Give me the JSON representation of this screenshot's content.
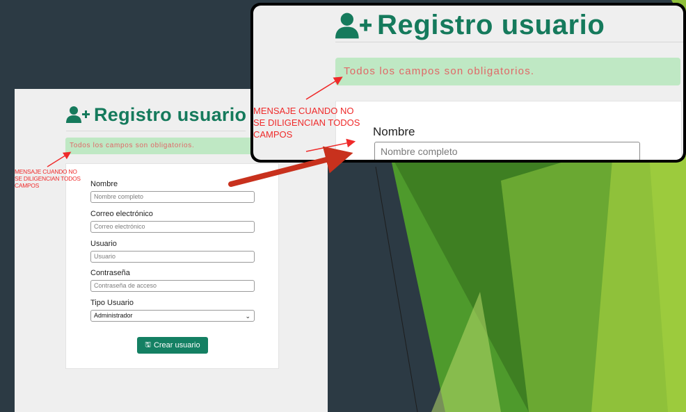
{
  "form": {
    "title": "Registro usuario",
    "alert": "Todos los campos son obligatorios.",
    "fields": [
      {
        "label": "Nombre",
        "placeholder": "Nombre completo"
      },
      {
        "label": "Correo electrónico",
        "placeholder": "Correo electrónico"
      },
      {
        "label": "Usuario",
        "placeholder": "Usuario"
      },
      {
        "label": "Contraseña",
        "placeholder": "Contraseña de acceso"
      }
    ],
    "tipo_label": "Tipo Usuario",
    "tipo_value": "Administrador",
    "submit_label": "Crear usuario",
    "save_glyph": "🖫"
  },
  "annotation": {
    "line1": "MENSAJE CUANDO NO",
    "line2": "SE DILIGENCIAN TODOS",
    "line3": "CAMPOS"
  },
  "icons": [
    "user-plus-icon",
    "save-icon",
    "chevron-down-icon"
  ],
  "colors": {
    "brand_green": "#157a5c",
    "button_green": "#148063",
    "alert_bg": "#bfe8c4",
    "alert_text": "#e06767",
    "annotation_red": "#ef2a2a",
    "slide_bg": "#2c3a44"
  }
}
